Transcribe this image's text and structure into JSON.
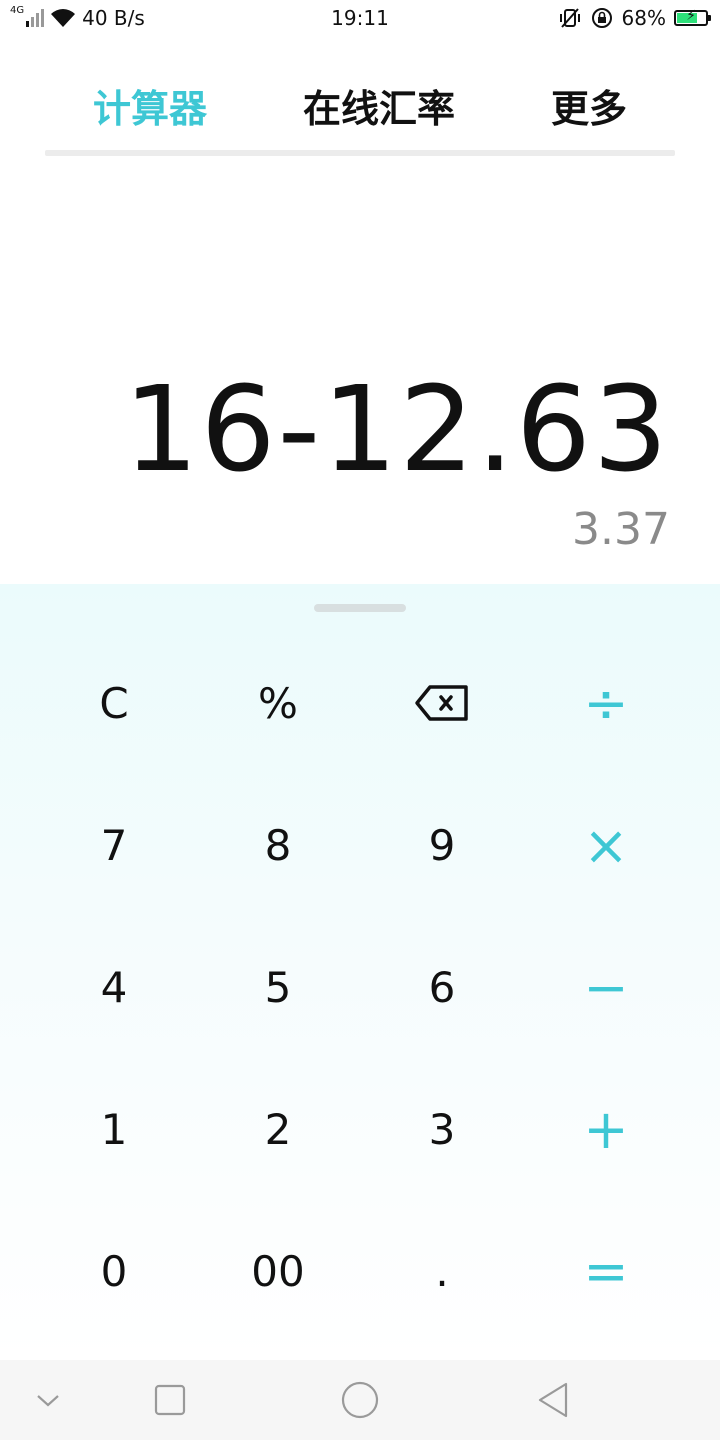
{
  "status_bar": {
    "network_type": "4G",
    "speed": "40 B/s",
    "time": "19:11",
    "battery_percent": "68%",
    "battery_level": 0.68,
    "icons": [
      "signal-icon",
      "wifi-icon",
      "vibrate-icon",
      "rotation-lock-icon",
      "battery-charging-icon"
    ]
  },
  "tabs": [
    {
      "label": "计算器",
      "active": true
    },
    {
      "label": "在线汇率",
      "active": false
    },
    {
      "label": "更多",
      "active": false
    }
  ],
  "display": {
    "expression": "16-12.63",
    "result": "3.37"
  },
  "keypad": {
    "rows": [
      [
        {
          "label": "C"
        },
        {
          "label": "%"
        },
        {
          "label": "⌫",
          "icon": "backspace-icon"
        },
        {
          "label": "÷",
          "op": true
        }
      ],
      [
        {
          "label": "7"
        },
        {
          "label": "8"
        },
        {
          "label": "9"
        },
        {
          "label": "×",
          "op": true
        }
      ],
      [
        {
          "label": "4"
        },
        {
          "label": "5"
        },
        {
          "label": "6"
        },
        {
          "label": "−",
          "op": true
        }
      ],
      [
        {
          "label": "1"
        },
        {
          "label": "2"
        },
        {
          "label": "3"
        },
        {
          "label": "+",
          "op": true
        }
      ],
      [
        {
          "label": "0"
        },
        {
          "label": "00"
        },
        {
          "label": "."
        },
        {
          "label": "=",
          "op": true
        }
      ]
    ]
  },
  "colors": {
    "accent": "#3ec7d4",
    "keypad_bg": "#ebfbfc",
    "result_text": "#8a8a8a"
  },
  "nav_bar": {
    "icons": [
      "chevron-down-icon",
      "recents-square-icon",
      "home-circle-icon",
      "back-triangle-icon"
    ]
  }
}
